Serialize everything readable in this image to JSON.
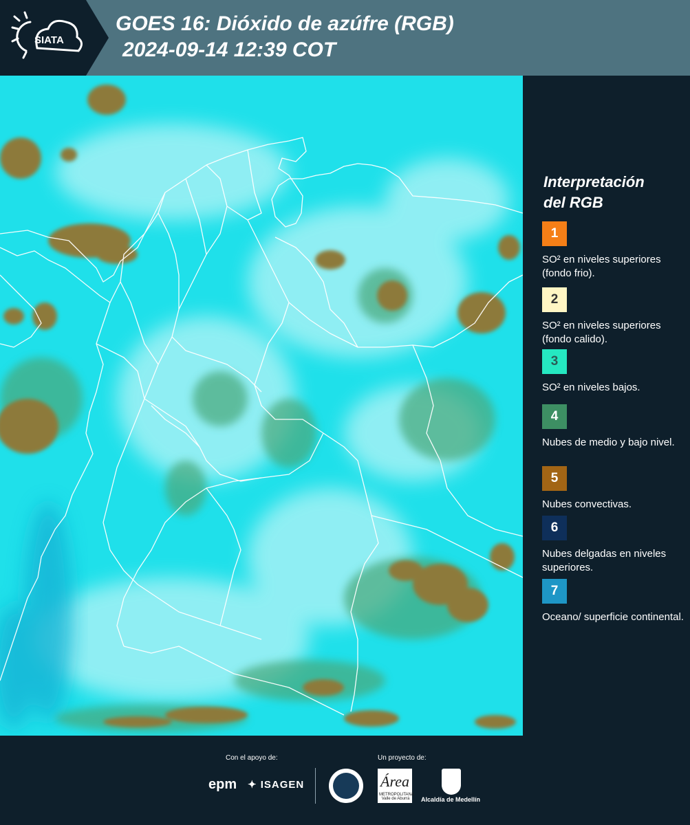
{
  "header": {
    "logo_text": "SIATA",
    "title_line1": "GOES 16: Dióxido de azúfre (RGB)",
    "title_line2": "2024-09-14 12:39 COT"
  },
  "legend": {
    "title_line1": "Interpretación",
    "title_line2": "del RGB",
    "items": [
      {
        "num": "1",
        "color": "#f57f17",
        "text_color": "#ffffff",
        "label": "SO² en niveles superiores (fondo frio)."
      },
      {
        "num": "2",
        "color": "#fff6c4",
        "text_color": "#333333",
        "label": "SO² en niveles superiores (fondo calido)."
      },
      {
        "num": "3",
        "color": "#25e8c1",
        "text_color": "#2b5d57",
        "label": "SO² en niveles bajos."
      },
      {
        "num": "4",
        "color": "#3d8f63",
        "text_color": "#ffffff",
        "label": "Nubes de medio y bajo nivel."
      },
      {
        "num": "5",
        "color": "#a26515",
        "text_color": "#ffffff",
        "label": "Nubes convectivas."
      },
      {
        "num": "6",
        "color": "#0e2f5a",
        "text_color": "#ffffff",
        "label": "Nubes delgadas en niveles superiores."
      },
      {
        "num": "7",
        "color": "#1e96c6",
        "text_color": "#ffffff",
        "label": "Oceano/ superficie continental."
      }
    ]
  },
  "footer": {
    "support_label": "Con el apoyo de:",
    "project_label": "Un proyecto de:",
    "epm": "epm",
    "isagen": "ISAGEN",
    "area_logo": "Área",
    "area_sub": "METROPOLITANA Valle de Aburrá",
    "alcaldia": "Alcaldía de Medellín"
  },
  "map": {
    "background_color": "#1fe0ea",
    "cloud_color": "#8d7a3a",
    "border_color": "#ffffff"
  }
}
